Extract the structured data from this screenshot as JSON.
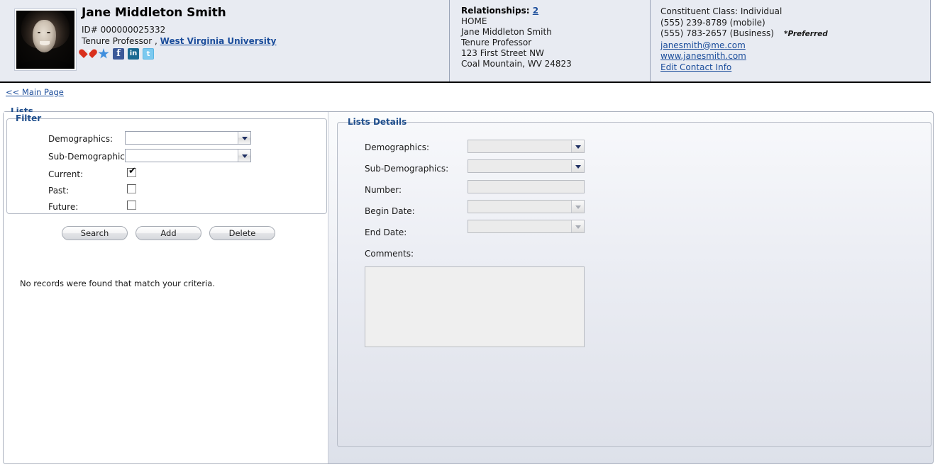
{
  "header": {
    "person": {
      "name": "Jane Middleton Smith",
      "id_label": "ID# 000000025332",
      "title": "Tenure Professor ,",
      "organization": "West Virginia University",
      "photo_alt": "portrait-photo",
      "social_icons": [
        {
          "name": "heart-question-icon",
          "glyph": "?"
        },
        {
          "name": "star-icon",
          "glyph": ""
        },
        {
          "name": "facebook-icon",
          "glyph": "f"
        },
        {
          "name": "linkedin-icon",
          "glyph": "in"
        },
        {
          "name": "twitter-icon",
          "glyph": "t"
        }
      ]
    },
    "relationships": {
      "label": "Relationships:",
      "count": "2",
      "lines": [
        "HOME",
        "Jane Middleton Smith",
        "Tenure Professor",
        "123 First Street NW",
        "Coal Mountain, WV 24823"
      ]
    },
    "contact": {
      "constituent_class": "Constituent Class: Individual",
      "phone_mobile": "(555) 239-8789 (mobile)",
      "phone_business": "(555) 783-2657 (Business)",
      "preferred_marker": "*Preferred",
      "email": "janesmith@me.com",
      "website": "www.janesmith.com",
      "edit_link": "Edit Contact Info"
    }
  },
  "nav": {
    "main_page_link": "<< Main Page"
  },
  "lists": {
    "legend": "Lists",
    "filter": {
      "legend": "Filter",
      "fields": [
        {
          "label": "Demographics:",
          "value": "",
          "type": "combo"
        },
        {
          "label": "Sub-Demographics:",
          "value": "",
          "type": "combo"
        }
      ],
      "checkboxes": [
        {
          "label": "Current:",
          "checked": true,
          "tick": "✔"
        },
        {
          "label": "Past:",
          "checked": false,
          "tick": ""
        },
        {
          "label": "Future:",
          "checked": false,
          "tick": ""
        }
      ]
    },
    "buttons": [
      {
        "label": "Search",
        "name": "search-button"
      },
      {
        "label": "Add",
        "name": "add-button"
      },
      {
        "label": "Delete",
        "name": "delete-button"
      }
    ],
    "results_message": "No records were found that match your criteria.",
    "details": {
      "legend": "Lists Details",
      "fields": [
        {
          "label": "Demographics:",
          "value": "",
          "type": "combo",
          "disabled": true,
          "arrow": "dark"
        },
        {
          "label": "Sub-Demographics:",
          "value": "",
          "type": "combo",
          "disabled": true,
          "arrow": "dark"
        },
        {
          "label": "Number:",
          "value": "",
          "type": "text",
          "disabled": true,
          "arrow": "none"
        },
        {
          "label": "Begin Date:",
          "value": "",
          "type": "combo",
          "disabled": true,
          "arrow": "dim"
        },
        {
          "label": "End Date:",
          "value": "",
          "type": "combo",
          "disabled": true,
          "arrow": "dim"
        },
        {
          "label": "Comments:",
          "value": "",
          "type": "textarea",
          "disabled": true,
          "arrow": "none"
        }
      ]
    }
  },
  "colors": {
    "link": "#1b4d9b",
    "legend": "#1f4e8c",
    "header_bg": "#e8ebf2",
    "panel_bg": "#eef0f5"
  }
}
